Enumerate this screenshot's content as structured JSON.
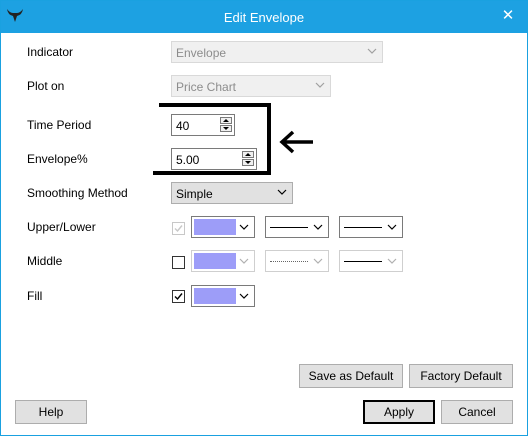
{
  "window": {
    "title": "Edit Envelope",
    "close_glyph": "✕"
  },
  "fields": {
    "indicator": {
      "label": "Indicator",
      "value": "Envelope"
    },
    "plot_on": {
      "label": "Plot on",
      "value": "Price Chart"
    },
    "time_period": {
      "label": "Time Period",
      "value": "40"
    },
    "envelope_pct": {
      "label": "Envelope%",
      "value": "5.00"
    },
    "smoothing": {
      "label": "Smoothing Method",
      "value": "Simple"
    },
    "upper_lower": {
      "label": "Upper/Lower",
      "checked": true,
      "enabled": false
    },
    "middle": {
      "label": "Middle",
      "checked": false,
      "enabled": true
    },
    "fill": {
      "label": "Fill",
      "checked": true,
      "enabled": true
    }
  },
  "colors": {
    "swatch": "#9d9df8",
    "titlebar": "#1da1e2"
  },
  "icons": {
    "app": "bull-horns-icon",
    "arrow": "left-arrow-icon"
  },
  "buttons": {
    "save_default": "Save as Default",
    "factory_default": "Factory Default",
    "help": "Help",
    "apply": "Apply",
    "cancel": "Cancel"
  }
}
